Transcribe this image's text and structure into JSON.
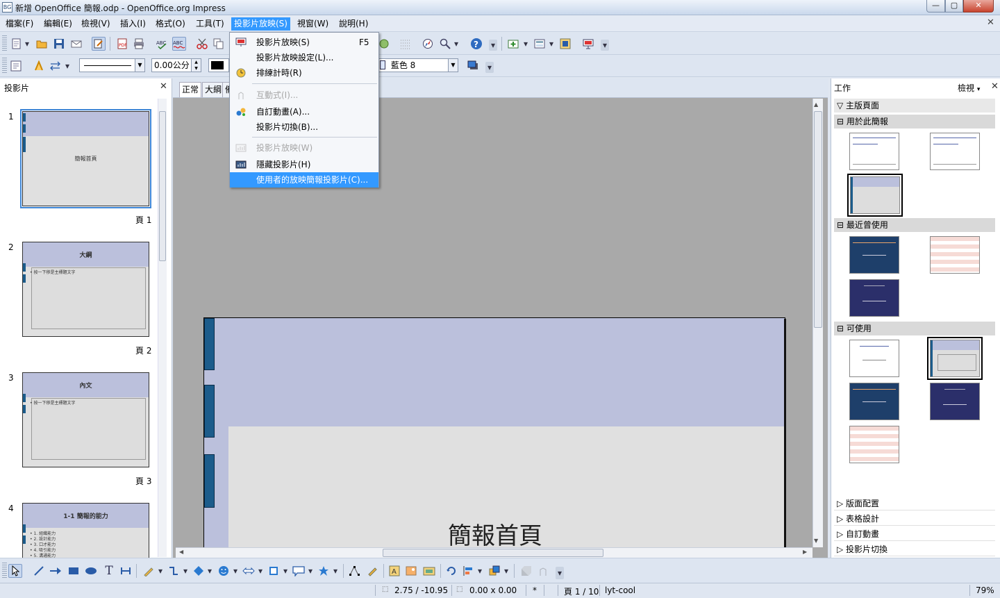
{
  "window": {
    "title": "新增 OpenOffice 簡報.odp - OpenOffice.org Impress",
    "app_icon_text": "BG",
    "minimize": "—",
    "maximize": "▢",
    "close": "✕"
  },
  "menubar": {
    "items": [
      "檔案(F)",
      "編輯(E)",
      "檢視(V)",
      "插入(I)",
      "格式(O)",
      "工具(T)",
      "投影片放映(S)",
      "視窗(W)",
      "說明(H)"
    ],
    "active_index": 6,
    "doc_close": "✕"
  },
  "toolbar2": {
    "line_width": "0.00公分",
    "area_color": "藍色 8"
  },
  "slide_menu": {
    "items": [
      {
        "label": "投影片放映(S)",
        "shortcut": "F5",
        "icon": "slideshow-icon",
        "enabled": true
      },
      {
        "label": "投影片放映設定(L)...",
        "shortcut": "",
        "icon": "",
        "enabled": true
      },
      {
        "label": "排練計時(R)",
        "shortcut": "",
        "icon": "timer-icon",
        "enabled": true
      },
      {
        "label": "互動式(I)...",
        "shortcut": "",
        "icon": "interaction-icon",
        "enabled": false
      },
      {
        "label": "自訂動畫(A)...",
        "shortcut": "",
        "icon": "custom-animation-icon",
        "enabled": true
      },
      {
        "label": "投影片切換(B)...",
        "shortcut": "",
        "icon": "",
        "enabled": true
      },
      {
        "label": "投影片放映(W)",
        "shortcut": "",
        "icon": "show-slide-icon",
        "enabled": false
      },
      {
        "label": "隱藏投影片(H)",
        "shortcut": "",
        "icon": "hide-slide-icon",
        "enabled": true
      },
      {
        "label": "使用者的放映簡報投影片(C)...",
        "shortcut": "",
        "icon": "",
        "enabled": true,
        "highlighted": true
      }
    ]
  },
  "slides_panel": {
    "title": "投影片",
    "close": "✕",
    "slides": [
      {
        "number": "1",
        "label": "頁 1",
        "title": "簡報首頁",
        "bullets": []
      },
      {
        "number": "2",
        "label": "頁 2",
        "title": "大綱",
        "bullets": [
          "• 按一下移是主標題文字"
        ]
      },
      {
        "number": "3",
        "label": "頁 3",
        "title": "內文",
        "bullets": [
          "• 按一下移是主標題文字"
        ]
      },
      {
        "number": "4",
        "label": "",
        "title": "1-1 簡報的能力",
        "bullets": [
          "• 1. 組織能力",
          "• 2. 設計能力",
          "• 3. 口才能力",
          "• 4. 吸引能力",
          "• 5. 溝通能力"
        ]
      }
    ]
  },
  "view_tabs": [
    "正常",
    "大綱",
    "備"
  ],
  "main_slide": {
    "title": "簡報首頁"
  },
  "task_panel": {
    "title": "工作",
    "view_label": "檢視",
    "close": "✕",
    "master_pages": "主版頁面",
    "used": "用於此簡報",
    "recent": "最近曾使用",
    "available": "可使用",
    "collapsed": [
      "版面配置",
      "表格設計",
      "自訂動畫",
      "投影片切換"
    ]
  },
  "statusbar": {
    "position": "2.75 / -10.95",
    "size": "0.00 x 0.00",
    "modified": "*",
    "page": "頁 1 / 10",
    "master": "lyt-cool",
    "zoom": "79%"
  },
  "colors": {
    "accent": "#3399ff",
    "slide_header": "#bbc0dc",
    "slide_bar": "#1c5c8b"
  }
}
